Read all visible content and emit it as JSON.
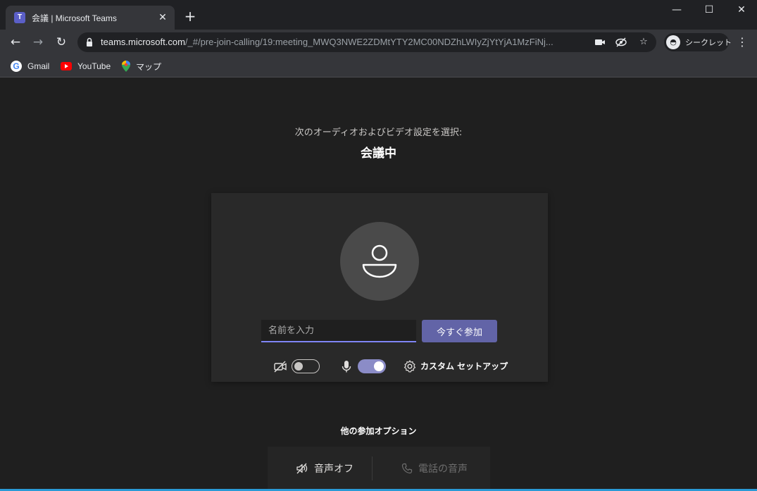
{
  "browser": {
    "tab_title": "会議 | Microsoft Teams",
    "tab_favicon_letter": "T",
    "tab_close": "✕",
    "new_tab": "+",
    "window_controls": {
      "minimize": "—",
      "maximize": "☐",
      "close": "✕"
    },
    "url_host": "teams.microsoft.com",
    "url_path": "/_#/pre-join-calling/19:meeting_MWQ3NWE2ZDMtYTY2MC00NDZhLWIyZjYtYjA1MzFiNj...",
    "incognito_label": "シークレット",
    "bookmarks": [
      {
        "label": "Gmail",
        "icon": "google-icon"
      },
      {
        "label": "YouTube",
        "icon": "youtube-icon"
      },
      {
        "label": "マップ",
        "icon": "maps-icon"
      }
    ]
  },
  "prejoin": {
    "subtitle": "次のオーディオおよびビデオ設定を選択:",
    "meeting_title": "会議中",
    "name_placeholder": "名前を入力",
    "join_label": "今すぐ参加",
    "camera_on": false,
    "mic_on": true,
    "custom_setup_label": "カスタム セットアップ",
    "other_options_title": "他の参加オプション",
    "audio_off_label": "音声オフ",
    "phone_audio_label": "電話の音声"
  },
  "colors": {
    "accent": "#6264a7",
    "toggle_on": "#8b8cc7",
    "input_underline": "#7f85f5",
    "page_bg": "#1f1f1f",
    "card_bg": "#292929"
  }
}
